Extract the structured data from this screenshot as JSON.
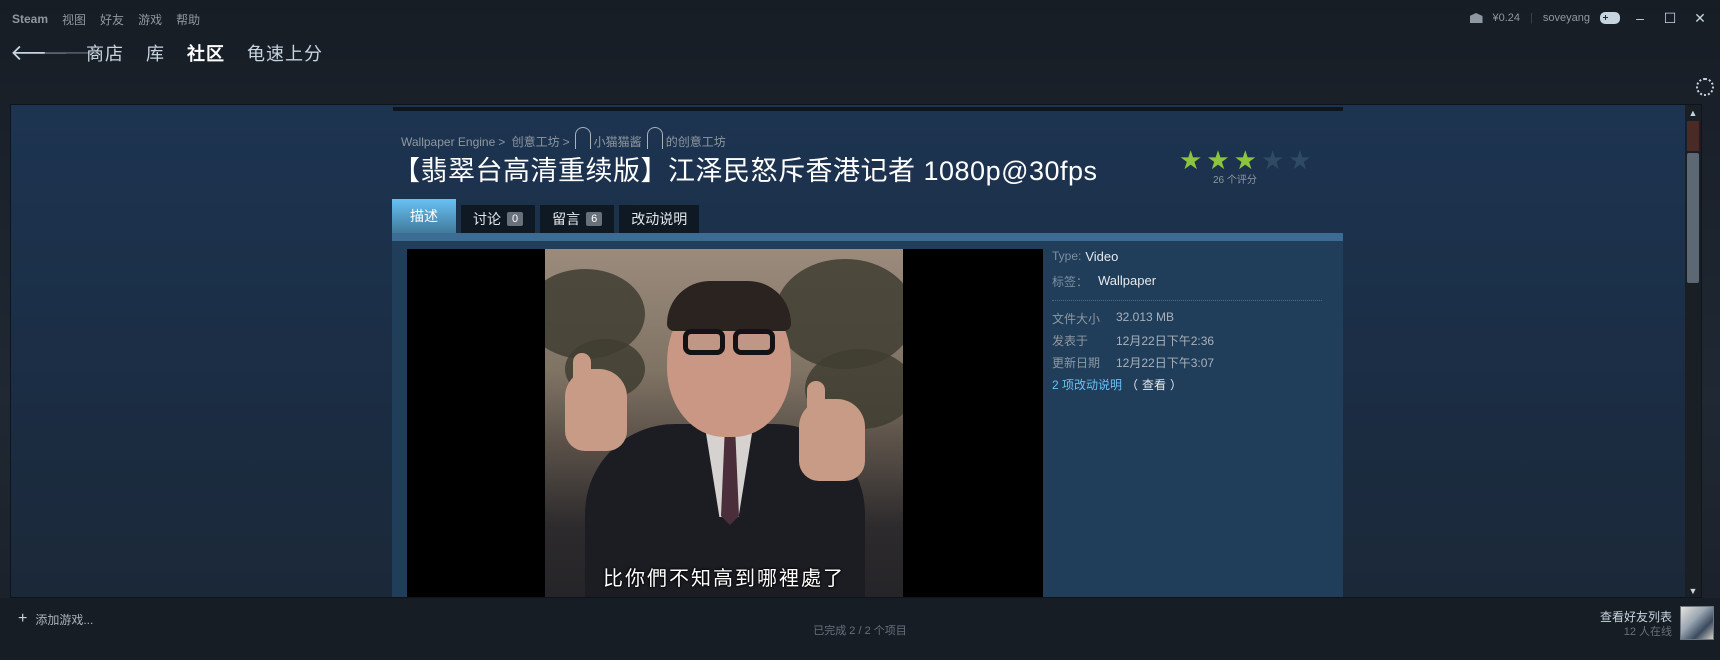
{
  "menubar": {
    "items": [
      "Steam",
      "视图",
      "好友",
      "游戏",
      "帮助"
    ],
    "wallet": "¥0.24",
    "separator": "|",
    "username": "soveyang",
    "minimize": "–",
    "maximize": "☐",
    "close": "✕"
  },
  "nav": {
    "back": "🡐",
    "forward": "🡒",
    "links": [
      "商店",
      "库",
      "社区",
      "龟速上分"
    ],
    "active": "社区"
  },
  "breadcrumb": {
    "app": "Wallpaper Engine",
    "sep1": ">",
    "workshop": "创意工坊",
    "sep2": ">",
    "author": "小猫猫酱",
    "suffix": "的创意工坊"
  },
  "item": {
    "title": "【翡翠台高清重续版】江泽民怒斥香港记者 1080p@30fps",
    "rating_stars": 3,
    "rating_max": 5,
    "rating_count_text": "26 个评分"
  },
  "tabs": [
    {
      "label": "描述",
      "badge": null,
      "active": true
    },
    {
      "label": "讨论",
      "badge": "0",
      "active": false
    },
    {
      "label": "留言",
      "badge": "6",
      "active": false
    },
    {
      "label": "改动说明",
      "badge": null,
      "active": false
    }
  ],
  "media": {
    "subtitle": "比你們不知高到哪裡處了"
  },
  "meta": {
    "type_label": "Type:",
    "type_value": "Video",
    "tag_label": "标签：",
    "tag_value": "Wallpaper",
    "size_label": "文件大小",
    "size_value": "32.013 MB",
    "posted_label": "发表于",
    "posted_value": "12月22日下午2:36",
    "updated_label": "更新日期",
    "updated_value": "12月22日下午3:07",
    "changes_link": "2 项改动说明",
    "view_open": "（",
    "view_label": "查看",
    "view_close": "）"
  },
  "bottombar": {
    "add_game": "添加游戏...",
    "progress": "已完成 2 / 2 个项目",
    "friends_title": "查看好友列表",
    "friends_online": "12 人在线"
  },
  "colors": {
    "accent": "#67c1f5",
    "star_on": "#8bc53f",
    "background": "#1b2838"
  }
}
